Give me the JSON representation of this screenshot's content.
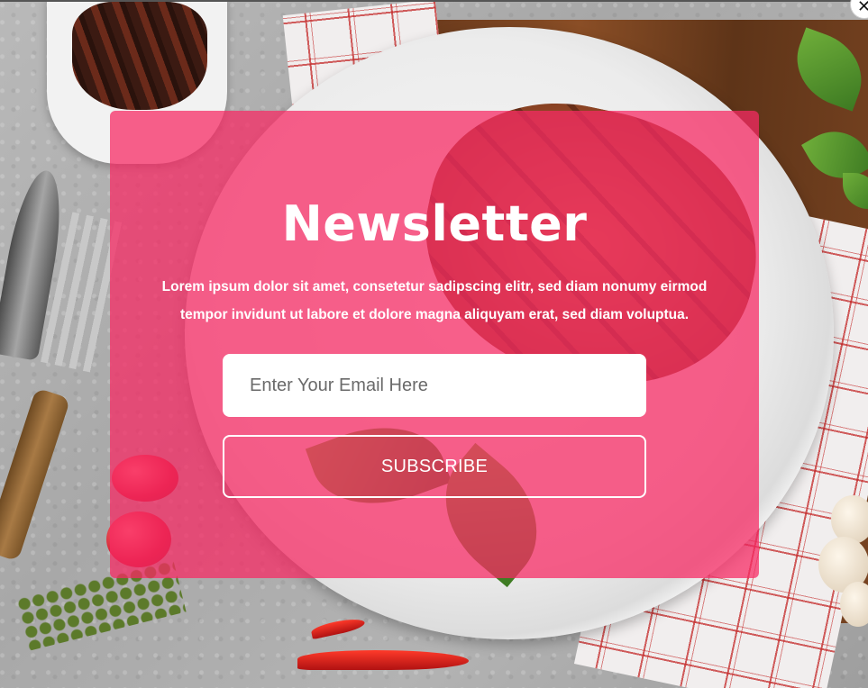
{
  "newsletter": {
    "title": "Newsletter",
    "description": "Lorem ipsum dolor sit amet, consetetur sadipscing elitr, sed diam nonumy eirmod tempor invidunt ut labore et dolore magna aliquyam erat, sed diam voluptua.",
    "email_placeholder": "Enter Your Email Here",
    "email_value": "",
    "subscribe_label": "SUBSCRIBE",
    "accent_color": "#f72a64"
  },
  "close": {
    "icon": "close-icon",
    "glyph": "✕"
  }
}
